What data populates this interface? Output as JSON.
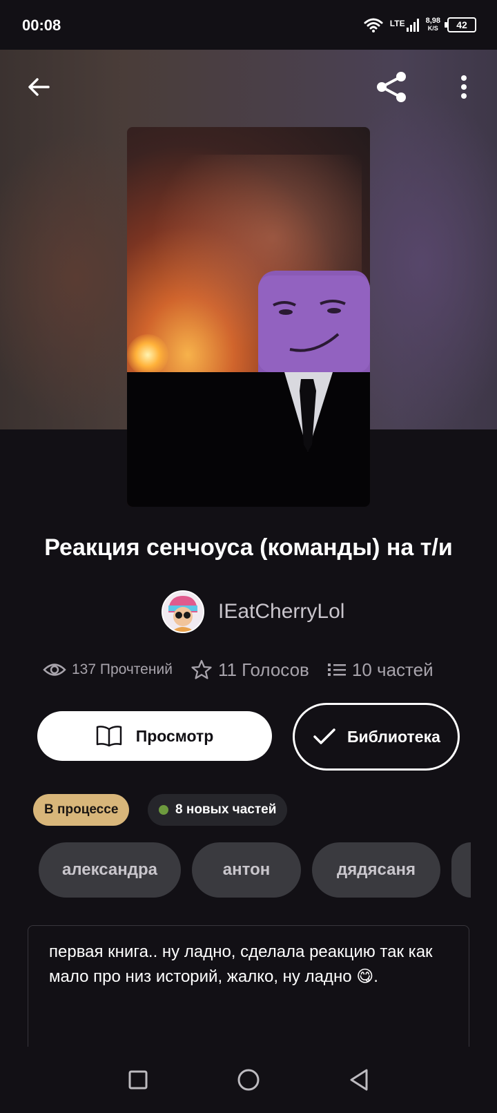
{
  "status_bar": {
    "time": "00:08",
    "network": "LTE",
    "speed_value": "8,98",
    "speed_unit": "K/S",
    "battery": "42"
  },
  "story": {
    "title": "Реакция сенчоуса (команды) на т/и",
    "author": "IEatCherryLol",
    "reads_label": "137 Прочтений",
    "votes_label": "11 Голосов",
    "parts_label": "10 частей"
  },
  "actions": {
    "view_label": "Просмотр",
    "library_label": "Библиотека"
  },
  "badges": {
    "status": "В процессе",
    "new_parts": "8 новых частей",
    "new_parts_dot_color": "#6d9a3e",
    "status_color": "#d8b67a"
  },
  "tags": [
    "александра",
    "антон",
    "дядясаня",
    ""
  ],
  "description": {
    "text": "первая книга.. ну ладно, сделала реакцию так как мало про низ историй, жалко, ну ладно 😋."
  },
  "icons": {
    "back": "arrow-left-icon",
    "share": "share-icon",
    "more": "more-vertical-icon",
    "eye": "eye-icon",
    "star": "star-icon",
    "list": "list-icon",
    "book": "book-icon",
    "check": "check-icon"
  }
}
